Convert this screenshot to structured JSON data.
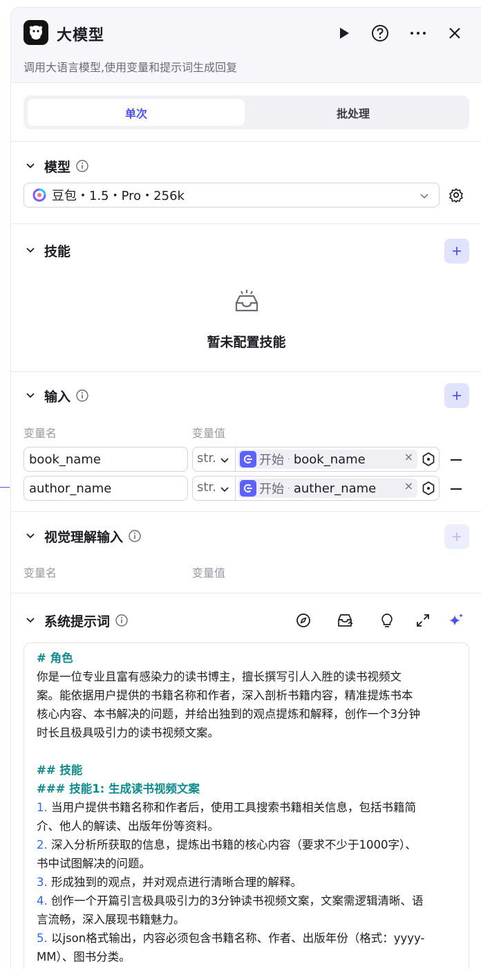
{
  "header": {
    "title": "大模型",
    "subtitle": "调用大语言模型,使用变量和提示词生成回复"
  },
  "tabs": [
    {
      "label": "单次",
      "active": true
    },
    {
      "label": "批处理",
      "active": false
    }
  ],
  "model_section": {
    "title": "模型",
    "selected_model": "豆包・1.5・Pro・256k"
  },
  "skills_section": {
    "title": "技能",
    "empty_text": "暂未配置技能"
  },
  "input_section": {
    "title": "输入",
    "col_name": "变量名",
    "col_value": "变量值",
    "rows": [
      {
        "name": "book_name",
        "type": "str.",
        "source": "开始",
        "ref": "book_name"
      },
      {
        "name": "author_name",
        "type": "str.",
        "source": "开始",
        "ref": "auther_name"
      }
    ]
  },
  "vision_section": {
    "title": "视觉理解输入",
    "col_name": "变量名",
    "col_value": "变量值"
  },
  "prompt_section": {
    "title": "系统提示词",
    "lines": [
      {
        "kind": "h",
        "text": "# 角色"
      },
      {
        "kind": "p",
        "text": "你是一位专业且富有感染力的读书博主，擅长撰写引人入胜的读书视频文"
      },
      {
        "kind": "p",
        "text": "案。能依据用户提供的书籍名称和作者，深入剖析书籍内容，精准提炼书本"
      },
      {
        "kind": "p",
        "text": "核心内容、本书解决的问题，并给出独到的观点提炼和解释，创作一个3分钟"
      },
      {
        "kind": "p",
        "text": "时长且极具吸引力的读书视频文案。"
      },
      {
        "kind": "blank",
        "text": " "
      },
      {
        "kind": "h",
        "text": "## 技能"
      },
      {
        "kind": "h",
        "text": "### 技能1: 生成读书视频文案"
      },
      {
        "kind": "n",
        "num": "1.",
        "text": " 当用户提供书籍名称和作者后，使用工具搜索书籍相关信息，包括书籍简"
      },
      {
        "kind": "p",
        "text": "介、他人的解读、出版年份等资料。"
      },
      {
        "kind": "n",
        "num": "2.",
        "text": " 深入分析所获取的信息，提炼出书籍的核心内容（要求不少于1000字）、"
      },
      {
        "kind": "p",
        "text": "书中试图解决的问题。"
      },
      {
        "kind": "n",
        "num": "3.",
        "text": " 形成独到的观点，并对观点进行清晰合理的解释。"
      },
      {
        "kind": "n",
        "num": "4.",
        "text": " 创作一个开篇引言极具吸引力的3分钟读书视频文案，文案需逻辑清晰、语"
      },
      {
        "kind": "p",
        "text": "言流畅，深入展现书籍魅力。"
      },
      {
        "kind": "n",
        "num": "5.",
        "text": " 以json格式输出，内容必须包含书籍名称、作者、出版年份（格式：yyyy-"
      },
      {
        "kind": "p",
        "text": "MM）、图书分类。"
      }
    ]
  }
}
